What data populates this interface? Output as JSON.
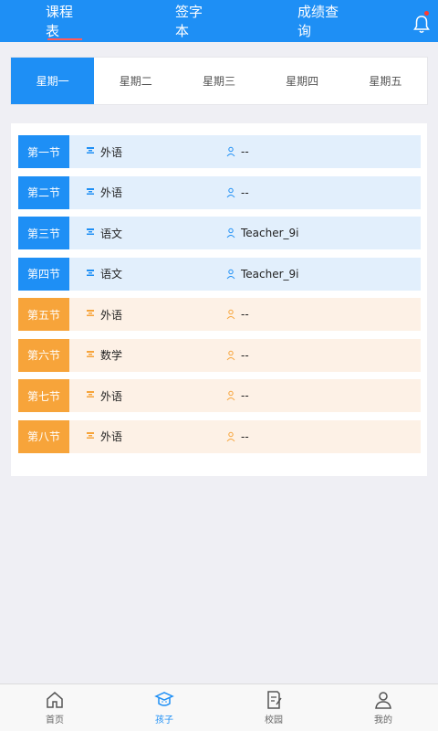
{
  "header": {
    "tabs": [
      {
        "label": "课程表",
        "active": true
      },
      {
        "label": "签字本",
        "active": false
      },
      {
        "label": "成绩查询",
        "active": false
      }
    ],
    "icon": "bell-icon"
  },
  "weekdays": [
    {
      "label": "星期一",
      "active": true
    },
    {
      "label": "星期二",
      "active": false
    },
    {
      "label": "星期三",
      "active": false
    },
    {
      "label": "星期四",
      "active": false
    },
    {
      "label": "星期五",
      "active": false
    }
  ],
  "schedule": [
    {
      "period": "第一节",
      "subject": "外语",
      "teacher": "--",
      "color": "blue"
    },
    {
      "period": "第二节",
      "subject": "外语",
      "teacher": "--",
      "color": "blue"
    },
    {
      "period": "第三节",
      "subject": "语文",
      "teacher": "Teacher_9i",
      "color": "blue"
    },
    {
      "period": "第四节",
      "subject": "语文",
      "teacher": "Teacher_9i",
      "color": "blue"
    },
    {
      "period": "第五节",
      "subject": "外语",
      "teacher": "--",
      "color": "orange"
    },
    {
      "period": "第六节",
      "subject": "数学",
      "teacher": "--",
      "color": "orange"
    },
    {
      "period": "第七节",
      "subject": "外语",
      "teacher": "--",
      "color": "orange"
    },
    {
      "period": "第八节",
      "subject": "外语",
      "teacher": "--",
      "color": "orange"
    }
  ],
  "bottom_nav": [
    {
      "label": "首页",
      "icon": "home-icon",
      "active": false
    },
    {
      "label": "孩子",
      "icon": "graduation-cap-icon",
      "active": true
    },
    {
      "label": "校园",
      "icon": "document-edit-icon",
      "active": false
    },
    {
      "label": "我的",
      "icon": "user-icon",
      "active": false
    }
  ],
  "colors": {
    "primary": "#1e8ff5",
    "morning_row": "#e2effc",
    "afternoon_label": "#f7a43a",
    "afternoon_row": "#fdf1e6",
    "notification_dot": "#ff3b30"
  }
}
